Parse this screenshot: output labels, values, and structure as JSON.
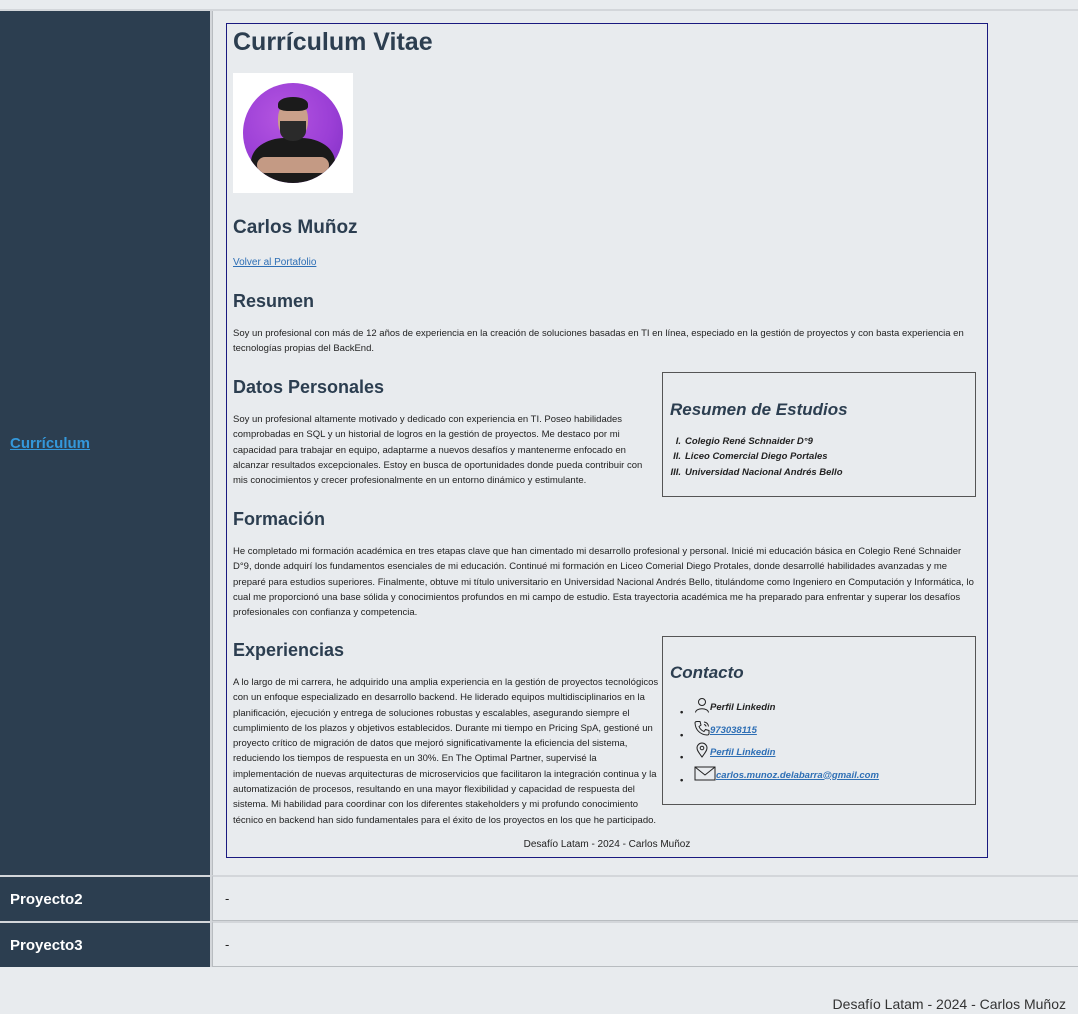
{
  "sidebar": {
    "items": [
      {
        "label": "Currículum"
      },
      {
        "label": "Proyecto2"
      },
      {
        "label": "Proyecto3"
      }
    ]
  },
  "rows": {
    "proyecto2_content": "-",
    "proyecto3_content": "-"
  },
  "cv": {
    "title": "Currículum Vitae",
    "name": "Carlos Muñoz",
    "back_link": "Volver al Portafolio",
    "resumen": {
      "title": "Resumen",
      "text": "Soy un profesional con más de 12 años de experiencia en la creación de soluciones basadas en TI en línea, especiado en la gestión de proyectos y con basta experiencia en tecnologías propias del BackEnd."
    },
    "datos": {
      "title": "Datos Personales",
      "text": "Soy un profesional altamente motivado y dedicado con experiencia en TI. Poseo habilidades comprobadas en SQL y un historial de logros en la gestión de proyectos. Me destaco por mi capacidad para trabajar en equipo, adaptarme a nuevos desafíos y mantenerme enfocado en alcanzar resultados excepcionales. Estoy en busca de oportunidades donde pueda contribuir con mis conocimientos y crecer profesionalmente en un entorno dinámico y estimulante."
    },
    "estudios": {
      "title": "Resumen de Estudios",
      "items": [
        {
          "num": "I.",
          "text": "Colegio René Schnaider D°9"
        },
        {
          "num": "II.",
          "text": "Liceo Comercial Diego Portales"
        },
        {
          "num": "III.",
          "text": "Universidad Nacional Andrés Bello"
        }
      ]
    },
    "formacion": {
      "title": "Formación",
      "text": "He completado mi formación académica en tres etapas clave que han cimentado mi desarrollo profesional y personal. Inicié mi educación básica en Colegio René Schnaider D°9, donde adquirí los fundamentos esenciales de mi educación. Continué mi formación en Liceo Comerial Diego Protales, donde desarrollé habilidades avanzadas y me preparé para estudios superiores. Finalmente, obtuve mi título universitario en Universidad Nacional Andrés Bello, titulándome como Ingeniero en Computación y Informática, lo cual me proporcionó una base sólida y conocimientos profundos en mi campo de estudio. Esta trayectoria académica me ha preparado para enfrentar y superar los desafíos profesionales con confianza y competencia."
    },
    "experiencias": {
      "title": "Experiencias",
      "text": "A lo largo de mi carrera, he adquirido una amplia experiencia en la gestión de proyectos tecnológicos con un enfoque especializado en desarrollo backend. He liderado equipos multidisciplinarios en la planificación, ejecución y entrega de soluciones robustas y escalables, asegurando siempre el cumplimiento de los plazos y objetivos establecidos. Durante mi tiempo en Pricing SpA, gestioné un proyecto crítico de migración de datos que mejoró significativamente la eficiencia del sistema, reduciendo los tiempos de respuesta en un 30%. En The Optimal Partner, supervisé la implementación de nuevas arquitecturas de microservicios que facilitaron la integración continua y la automatización de procesos, resultando en una mayor flexibilidad y capacidad de respuesta del sistema. Mi habilidad para coordinar con los diferentes stakeholders y mi profundo conocimiento técnico en backend han sido fundamentales para el éxito de los proyectos en los que he participado."
    },
    "contacto": {
      "title": "Contacto",
      "items": [
        {
          "icon": "user-icon",
          "text": "Perfil Linkedin"
        },
        {
          "icon": "phone-icon",
          "text": "973038115"
        },
        {
          "icon": "location-pin-icon",
          "text": "Perfil Linkedin"
        },
        {
          "icon": "mail-icon",
          "text": "carlos.munoz.delabarra@gmail.com"
        }
      ]
    },
    "footer": "Desafío Latam - 2024 - Carlos Muñoz"
  },
  "page_footer": "Desafío Latam - 2024 - Carlos Muñoz"
}
